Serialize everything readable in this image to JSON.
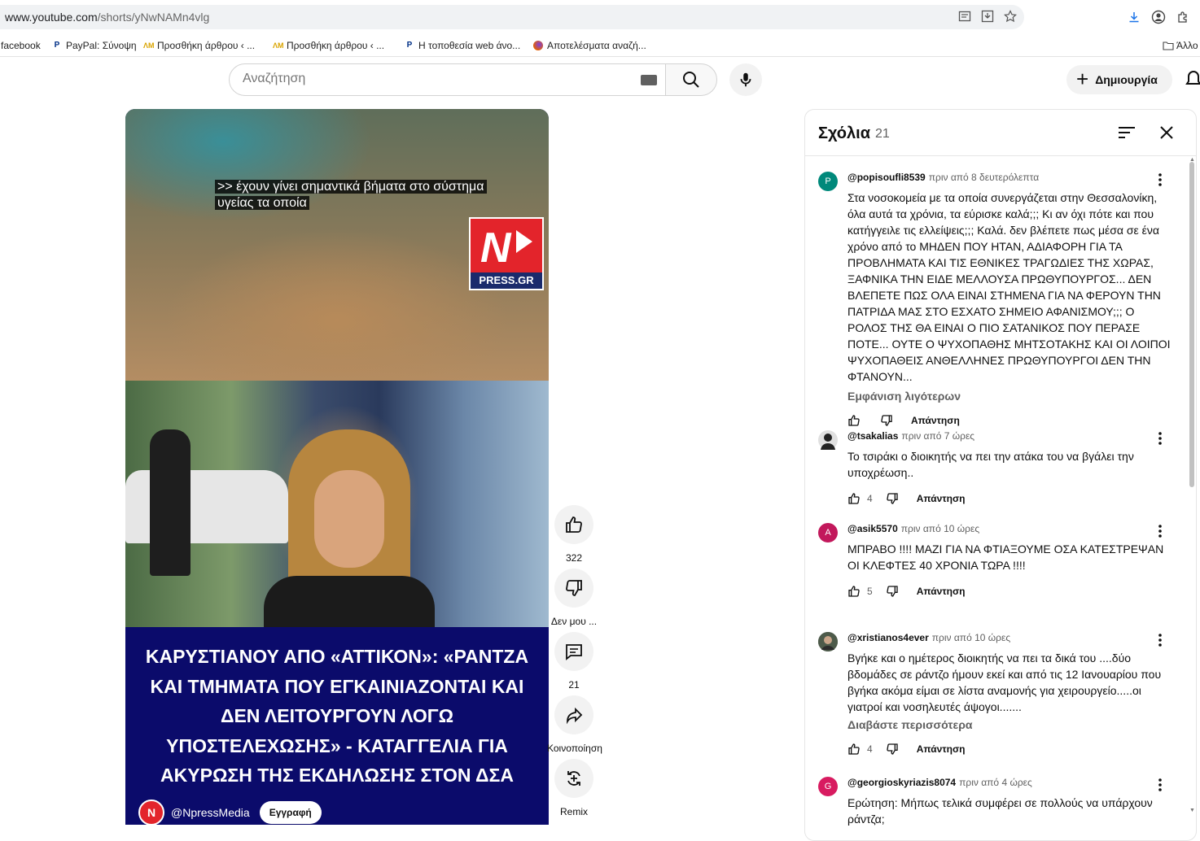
{
  "browser": {
    "url_domain": "www.youtube.com",
    "url_path": "/shorts/yNwNAMn4vlg",
    "bookmarks": [
      {
        "label": "facebook"
      },
      {
        "label": "PayPal: Σύνοψη"
      },
      {
        "label": "Προσθήκη άρθρου ‹ ..."
      },
      {
        "label": "Προσθήκη άρθρου ‹ ..."
      },
      {
        "label": "Η τοποθεσία web άνο..."
      },
      {
        "label": "Αποτελέσματα αναζή..."
      }
    ],
    "other_bookmarks": "Άλλο",
    "colors": {
      "accent": "#1a73e8",
      "paypal": "#003087",
      "firefox": "#e66000"
    }
  },
  "header": {
    "search_placeholder": "Αναζήτηση",
    "create_label": "Δημιουργία"
  },
  "video": {
    "caption_line1": ">> έχουν γίνει σημαντικά βήματα στο σύστημα",
    "caption_line2": "υγείας τα οποία",
    "logo_text": "PRESS.GR",
    "headline": "ΚΑΡΥΣΤΙΑΝΟΥ ΑΠΟ «ΑΤΤΙΚΟΝ»: «ΡΑΝΤΖΑ ΚΑΙ ΤΜΗΜΑΤΑ ΠΟΥ ΕΓΚΑΙΝΙΑΖΟΝΤΑΙ ΚΑΙ ΔΕΝ ΛΕΙΤΟΥΡΓΟΥΝ ΛΟΓΩ ΥΠΟΣΤΕΛΕΧΩΣΗΣ» - ΚΑΤΑΓΓΕΛΙΑ ΓΙΑ ΑΚΥΡΩΣΗ ΤΗΣ ΕΚΔΗΛΩΣΗΣ ΣΤΟΝ ΔΣΑ",
    "channel": "@NpressMedia",
    "subscribe": "Εγγραφή",
    "colors": {
      "headline_bg": "#0b0b6b",
      "logo_red": "#e3242b"
    }
  },
  "actions": {
    "likes": "322",
    "dislike": "Δεν μου ...",
    "comments": "21",
    "share": "Κοινοποίηση",
    "remix": "Remix"
  },
  "comments_panel": {
    "title": "Σχόλια",
    "count": "21",
    "items": [
      {
        "author": "@popisoufli8539",
        "time": "πριν από 8 δευτερόλεπτα",
        "text": "Στα νοσοκομεία με τα οποία συνεργάζεται στην Θεσσαλονίκη, όλα αυτά τα χρόνια, τα εύρισκε καλά;;; Κι αν όχι πότε και που κατήγγειλε τις ελλείψεις;;; Καλά. δεν βλέπετε πως μέσα σε ένα χρόνο από το ΜΗΔΕΝ ΠΟΥ ΗΤΑΝ, ΑΔΙΑΦΟΡΗ ΓΙΑ ΤΑ ΠΡΟΒΛΗΜΑΤΑ ΚΑΙ ΤΙΣ ΕΘΝΙΚΕΣ ΤΡΑΓΩΔΙΕΣ ΤΗΣ ΧΩΡΑΣ, ΞΑΦΝΙΚΑ ΤΗΝ ΕΙΔΕ ΜΕΛΛΟΥΣΑ ΠΡΩΘΥΠΟΥΡΓΟΣ... ΔΕΝ ΒΛΕΠΕΤΕ ΠΩΣ ΟΛΑ ΕΙΝΑΙ ΣΤΗΜΕΝΑ ΓΙΑ ΝΑ ΦΕΡΟΥΝ ΤΗΝ ΠΑΤΡΙΔΑ ΜΑΣ ΣΤΟ ΕΣΧΑΤΟ ΣΗΜΕΙΟ ΑΦΑΝΙΣΜΟΥ;;; Ο ΡΟΛΟΣ ΤΗΣ ΘΑ ΕΙΝΑΙ Ο ΠΙΟ ΣΑΤΑΝΙΚΟΣ ΠΟΥ ΠΕΡΑΣΕ ΠΟΤΕ... ΟΥΤΕ Ο ΨΥΧΟΠΑΘΗΣ ΜΗΤΣΟΤΑΚΗΣ ΚΑΙ ΟΙ ΛΟΙΠΟΙ ΨΥΧΟΠΑΘΕΙΣ ΑΝΘΕΛΛΗΝΕΣ ΠΡΩΘΥΠΟΥΡΓΟΙ ΔΕΝ ΤΗΝ ΦΤΑΝΟΥΝ...",
        "more": "Εμφάνιση λιγότερων",
        "likes": "",
        "reply": "Απάντηση",
        "avatar_letter": "P",
        "avatar_color": "#00897b"
      },
      {
        "author": "@tsakalias",
        "time": "πριν από 7 ώρες",
        "text": "Το τσιράκι ο διοικητής να πει την ατάκα του να βγάλει την υποχρέωση..",
        "more": "",
        "likes": "4",
        "reply": "Απάντηση",
        "avatar_letter": "",
        "avatar_color": "#333333"
      },
      {
        "author": "@asik5570",
        "time": "πριν από 10 ώρες",
        "text": "ΜΠΡΑΒΟ !!!! ΜΑΖΙ ΓΙΑ ΝΑ ΦΤΙΑΞΟΥΜΕ ΟΣΑ ΚΑΤΕΣΤΡΕΨΑΝ ΟΙ ΚΛΕΦΤΕΣ 40 ΧΡΟΝΙΑ ΤΩΡΑ !!!!",
        "more": "",
        "likes": "5",
        "reply": "Απάντηση",
        "avatar_letter": "A",
        "avatar_color": "#c2185b"
      },
      {
        "author": "@xristianos4ever",
        "time": "πριν από 10 ώρες",
        "text": "Βγήκε και ο ημέτερος διοικητής να πει τα δικά του ....δύο βδομάδες σε ράντζο ήμουν εκεί και από τις 12 Ιανουαρίου που βγήκα ακόμα είμαι σε λίστα αναμονής για χειρουργείο.....οι γιατροί και νοσηλευτές άψογοι.......",
        "more": "Διαβάστε περισσότερα",
        "likes": "4",
        "reply": "Απάντηση",
        "avatar_letter": "",
        "avatar_color": "#5d6b5a"
      },
      {
        "author": "@georgioskyriazis8074",
        "time": "πριν από 4 ώρες",
        "text": "Ερώτηση: Μήπως τελικά συμφέρει σε πολλούς να υπάρχουν ράντζα;",
        "more": "",
        "likes": "",
        "reply": "",
        "avatar_letter": "G",
        "avatar_color": "#d81b60"
      }
    ]
  }
}
